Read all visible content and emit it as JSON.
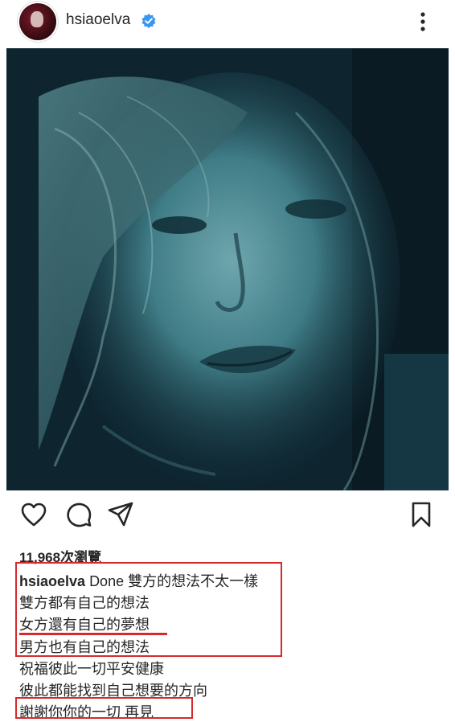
{
  "post": {
    "username": "hsiaoelva",
    "verified_icon": "verified-badge-icon",
    "menu_icon": "more-vertical-icon"
  },
  "actions": {
    "like_icon": "heart-icon",
    "comment_icon": "comment-icon",
    "share_icon": "send-icon",
    "save_icon": "bookmark-icon"
  },
  "views": {
    "count": "11,968",
    "unit": "次瀏覽"
  },
  "caption": {
    "username": "hsiaoelva",
    "line1": "Done 雙方的想法不太一樣",
    "line2": "雙方都有自己的想法",
    "line3": "女方還有自己的夢想",
    "line4": "男方也有自己的想法",
    "line5": "祝福彼此一切平安健康",
    "line6": "彼此都能找到自己想要的方向",
    "line7": "謝謝你你的一切  再見"
  },
  "colors": {
    "highlight": "#d62a2a",
    "verified": "#3897f0"
  }
}
